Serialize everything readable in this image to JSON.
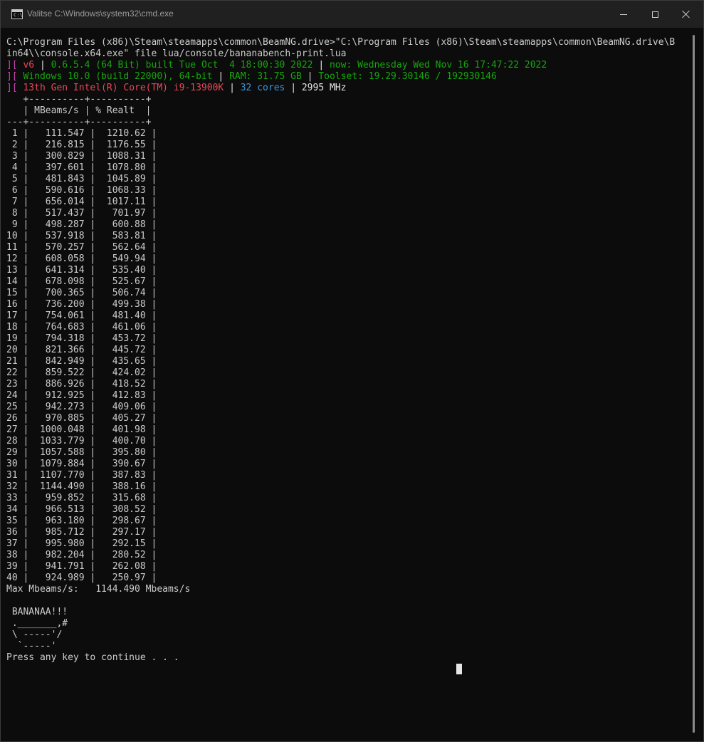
{
  "window": {
    "title": "Valitse C:\\Windows\\system32\\cmd.exe",
    "icon": "cmd-icon"
  },
  "colors": {
    "background": "#0c0c0c",
    "text": "#cccccc",
    "magenta": "#c73fad",
    "green": "#16a60c",
    "red": "#e74856",
    "cyan": "#3a96dd"
  },
  "console": {
    "command_line_1": "C:\\Program Files (x86)\\Steam\\steamapps\\common\\BeamNG.drive>\"C:\\Program Files (x86)\\Steam\\steamapps\\common\\BeamNG.drive\\B",
    "command_line_2": "in64\\\\console.x64.exe\" file lua/console/bananabench-print.lua",
    "info_line_1": {
      "prefix": "][",
      "v6": " v6 ",
      "sep1": "|",
      "version": " 0.6.5.4 (64 Bit) built Tue Oct  4 18:00:30 2022 ",
      "sep2": "|",
      "now": " now: Wednesday Wed Nov 16 17:47:22 2022"
    },
    "info_line_2": {
      "prefix": "][",
      "os": " Windows 10.0 (build 22000), 64-bit ",
      "sep1": "|",
      "ram": " RAM: 31.75 GB ",
      "sep2": "|",
      "toolset": " Toolset: 19.29.30146 / 192930146"
    },
    "info_line_3": {
      "prefix": "][",
      "cpu": " 13th Gen Intel(R) Core(TM) i9-13900K ",
      "sep1": "|",
      "cores": " 32 cores ",
      "sep2": "|",
      "mhz": " 2995 MHz"
    },
    "table_border_top": "   +----------+----------+",
    "table_header": "   | MBeams/s | % Realt  |",
    "table_border_mid": "---+----------+----------+",
    "rows": [
      " 1 |   111.547 |  1210.62 |",
      " 2 |   216.815 |  1176.55 |",
      " 3 |   300.829 |  1088.31 |",
      " 4 |   397.601 |  1078.80 |",
      " 5 |   481.843 |  1045.89 |",
      " 6 |   590.616 |  1068.33 |",
      " 7 |   656.014 |  1017.11 |",
      " 8 |   517.437 |   701.97 |",
      " 9 |   498.287 |   600.88 |",
      "10 |   537.918 |   583.81 |",
      "11 |   570.257 |   562.64 |",
      "12 |   608.058 |   549.94 |",
      "13 |   641.314 |   535.40 |",
      "14 |   678.098 |   525.67 |",
      "15 |   700.365 |   506.74 |",
      "16 |   736.200 |   499.38 |",
      "17 |   754.061 |   481.40 |",
      "18 |   764.683 |   461.06 |",
      "19 |   794.318 |   453.72 |",
      "20 |   821.366 |   445.72 |",
      "21 |   842.949 |   435.65 |",
      "22 |   859.522 |   424.02 |",
      "23 |   886.926 |   418.52 |",
      "24 |   912.925 |   412.83 |",
      "25 |   942.273 |   409.06 |",
      "26 |   970.885 |   405.27 |",
      "27 |  1000.048 |   401.98 |",
      "28 |  1033.779 |   400.70 |",
      "29 |  1057.588 |   395.80 |",
      "30 |  1079.884 |   390.67 |",
      "31 |  1107.770 |   387.83 |",
      "32 |  1144.490 |   388.16 |",
      "33 |   959.852 |   315.68 |",
      "34 |   966.513 |   308.52 |",
      "35 |   963.180 |   298.67 |",
      "36 |   985.712 |   297.17 |",
      "37 |   995.980 |   292.15 |",
      "38 |   982.204 |   280.52 |",
      "39 |   941.791 |   262.08 |",
      "40 |   924.989 |   250.97 |"
    ],
    "max_line": "Max Mbeams/s:   1144.490 Mbeams/s",
    "banana_1": " BANANAA!!!",
    "banana_2": " ._______,#",
    "banana_3": " \\ -----'/",
    "banana_4": "  `-----'",
    "prompt": "Press any key to continue . . ."
  }
}
